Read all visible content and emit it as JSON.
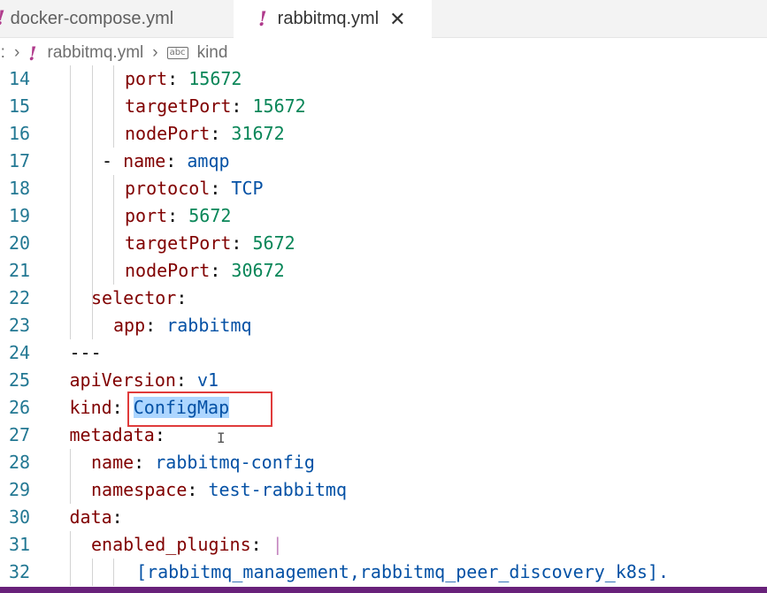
{
  "tabs": [
    {
      "label": "docker-compose.yml",
      "icon": "yaml-file-icon"
    },
    {
      "label": "rabbitmq.yml",
      "icon": "yaml-file-icon",
      "active": true
    }
  ],
  "tab_icon_glyph": "!",
  "close_glyph": "✕",
  "breadcrumb": {
    "root": "E:",
    "file": "rabbitmq.yml",
    "symbol_icon_text": "abc",
    "symbol": "kind"
  },
  "code_lines": [
    {
      "num": "14",
      "key": "port",
      "sep": ": ",
      "value": "15672",
      "vtype": "n"
    },
    {
      "num": "15",
      "key": "targetPort",
      "sep": ": ",
      "value": "15672",
      "vtype": "n"
    },
    {
      "num": "16",
      "key": "nodePort",
      "sep": ": ",
      "value": "31672",
      "vtype": "n"
    },
    {
      "num": "17",
      "prefix": "- ",
      "key": "name",
      "sep": ": ",
      "value": "amqp",
      "vtype": "s"
    },
    {
      "num": "18",
      "key": "protocol",
      "sep": ": ",
      "value": "TCP",
      "vtype": "s"
    },
    {
      "num": "19",
      "key": "port",
      "sep": ": ",
      "value": "5672",
      "vtype": "n"
    },
    {
      "num": "20",
      "key": "targetPort",
      "sep": ": ",
      "value": "5672",
      "vtype": "n"
    },
    {
      "num": "21",
      "key": "nodePort",
      "sep": ": ",
      "value": "30672",
      "vtype": "n"
    },
    {
      "num": "22",
      "key": "selector",
      "sep": ":",
      "value": "",
      "vtype": "s"
    },
    {
      "num": "23",
      "key": "app",
      "sep": ": ",
      "value": "rabbitmq",
      "vtype": "s"
    },
    {
      "num": "24",
      "plain": "---"
    },
    {
      "num": "25",
      "key": "apiVersion",
      "sep": ": ",
      "value": "v1",
      "vtype": "s"
    },
    {
      "num": "26",
      "key": "kind",
      "sep": ": ",
      "value": "ConfigMap",
      "vtype": "s",
      "selected": true
    },
    {
      "num": "27",
      "key": "metadata",
      "sep": ":",
      "value": "",
      "vtype": "s"
    },
    {
      "num": "28",
      "key": "name",
      "sep": ": ",
      "value": "rabbitmq-config",
      "vtype": "s"
    },
    {
      "num": "29",
      "key": "namespace",
      "sep": ": ",
      "value": "test-rabbitmq",
      "vtype": "s"
    },
    {
      "num": "30",
      "key": "data",
      "sep": ":",
      "value": "",
      "vtype": "s"
    },
    {
      "num": "31",
      "key": "enabled_plugins",
      "sep": ": ",
      "value": "|",
      "vtype": "bar"
    },
    {
      "num": "32",
      "plain_value": "[rabbitmq_management,rabbitmq_peer_discovery_k8s]."
    }
  ],
  "colors": {
    "key": "#800000",
    "number": "#098658",
    "string": "#0451a5",
    "line_number": "#237893",
    "selection": "#add6ff",
    "annotation_box": "#e03b3b",
    "status_bar": "#68217a"
  }
}
